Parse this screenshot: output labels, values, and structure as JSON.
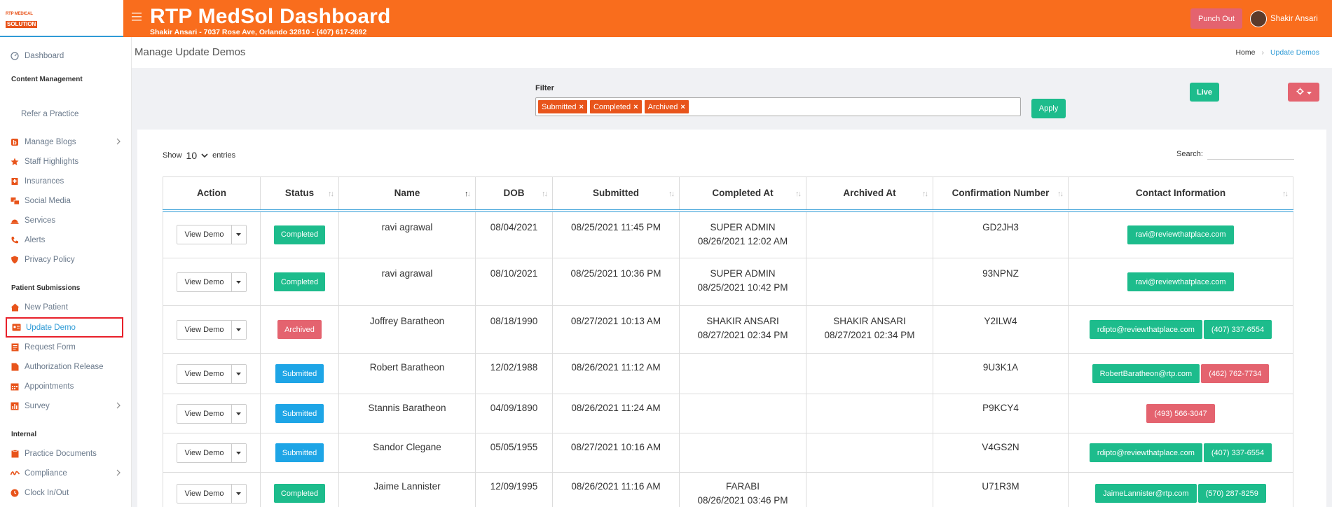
{
  "logo": {
    "line1": "RTP MEDICAL",
    "line2": "SOLUTION"
  },
  "header": {
    "title": "RTP MedSol Dashboard",
    "subtitle": "Shakir Ansari - 7037 Rose Ave, Orlando 32810 - (407) 617-2692",
    "punch_out": "Punch Out",
    "user_name": "Shakir Ansari"
  },
  "sidebar": {
    "dashboard": "Dashboard",
    "section_content": "Content Management",
    "refer": "Refer a Practice",
    "manage_blogs": "Manage Blogs",
    "staff_highlights": "Staff Highlights",
    "insurances": "Insurances",
    "social_media": "Social Media",
    "services": "Services",
    "alerts": "Alerts",
    "privacy_policy": "Privacy Policy",
    "section_patient": "Patient Submissions",
    "new_patient": "New Patient",
    "update_demo": "Update Demo",
    "request_form": "Request Form",
    "authorization_release": "Authorization Release",
    "appointments": "Appointments",
    "survey": "Survey",
    "section_internal": "Internal",
    "practice_documents": "Practice Documents",
    "compliance": "Compliance",
    "clock": "Clock In/Out"
  },
  "page": {
    "title": "Manage Update Demos",
    "breadcrumb_home": "Home",
    "breadcrumb_current": "Update Demos"
  },
  "filter": {
    "label": "Filter",
    "tags": [
      "Submitted",
      "Completed",
      "Archived"
    ],
    "apply": "Apply",
    "live": "Live"
  },
  "table_controls": {
    "show": "Show",
    "entries_value": "10",
    "entries": "entries",
    "search_label": "Search:"
  },
  "columns": [
    "Action",
    "Status",
    "Name",
    "DOB",
    "Submitted",
    "Completed At",
    "Archived At",
    "Confirmation Number",
    "Contact Information"
  ],
  "view_label": "View Demo",
  "rows": [
    {
      "status": "Completed",
      "status_type": "completed",
      "name": "ravi agrawal",
      "dob": "08/04/2021",
      "submitted": "08/25/2021 11:45 PM",
      "completed_by": "SUPER ADMIN",
      "completed_at": "08/26/2021 12:02 AM",
      "archived_by": "",
      "archived_at": "",
      "confirmation": "GD2JH3",
      "email": "ravi@reviewthatplace.com",
      "phone": ""
    },
    {
      "status": "Completed",
      "status_type": "completed",
      "name": "ravi agrawal",
      "dob": "08/10/2021",
      "submitted": "08/25/2021 10:36 PM",
      "completed_by": "SUPER ADMIN",
      "completed_at": "08/25/2021 10:42 PM",
      "archived_by": "",
      "archived_at": "",
      "confirmation": "93NPNZ",
      "email": "ravi@reviewthatplace.com",
      "phone": ""
    },
    {
      "status": "Archived",
      "status_type": "archived",
      "name": "Joffrey Baratheon",
      "dob": "08/18/1990",
      "submitted": "08/27/2021 10:13 AM",
      "completed_by": "SHAKIR ANSARI",
      "completed_at": "08/27/2021 02:34 PM",
      "archived_by": "SHAKIR ANSARI",
      "archived_at": "08/27/2021 02:34 PM",
      "confirmation": "Y2ILW4",
      "email": "rdipto@reviewthatplace.com",
      "phone": "(407) 337-6554",
      "phone_color": "green"
    },
    {
      "status": "Submitted",
      "status_type": "submitted",
      "name": "Robert Baratheon",
      "dob": "12/02/1988",
      "submitted": "08/26/2021 11:12 AM",
      "completed_by": "",
      "completed_at": "",
      "archived_by": "",
      "archived_at": "",
      "confirmation": "9U3K1A",
      "email": "RobertBaratheon@rtp.com",
      "phone": "(462) 762-7734",
      "phone_color": "red"
    },
    {
      "status": "Submitted",
      "status_type": "submitted",
      "name": "Stannis Baratheon",
      "dob": "04/09/1890",
      "submitted": "08/26/2021 11:24 AM",
      "completed_by": "",
      "completed_at": "",
      "archived_by": "",
      "archived_at": "",
      "confirmation": "P9KCY4",
      "email": "",
      "phone": "(493) 566-3047",
      "phone_color": "red"
    },
    {
      "status": "Submitted",
      "status_type": "submitted",
      "name": "Sandor Clegane",
      "dob": "05/05/1955",
      "submitted": "08/27/2021 10:16 AM",
      "completed_by": "",
      "completed_at": "",
      "archived_by": "",
      "archived_at": "",
      "confirmation": "V4GS2N",
      "email": "rdipto@reviewthatplace.com",
      "phone": "(407) 337-6554",
      "phone_color": "green"
    },
    {
      "status": "Completed",
      "status_type": "completed",
      "name": "Jaime Lannister",
      "dob": "12/09/1995",
      "submitted": "08/26/2021 11:16 AM",
      "completed_by": "FARABI",
      "completed_at": "08/26/2021 03:46 PM",
      "archived_by": "",
      "archived_at": "",
      "confirmation": "U71R3M",
      "email": "JaimeLannister@rtp.com",
      "phone": "(570) 287-8259",
      "phone_color": "green"
    }
  ],
  "colors": {
    "brand": "#f96d1d",
    "green": "#1dbc8c",
    "red": "#e4636f",
    "blue": "#1ea5e6",
    "accent": "#2f9bd6"
  }
}
